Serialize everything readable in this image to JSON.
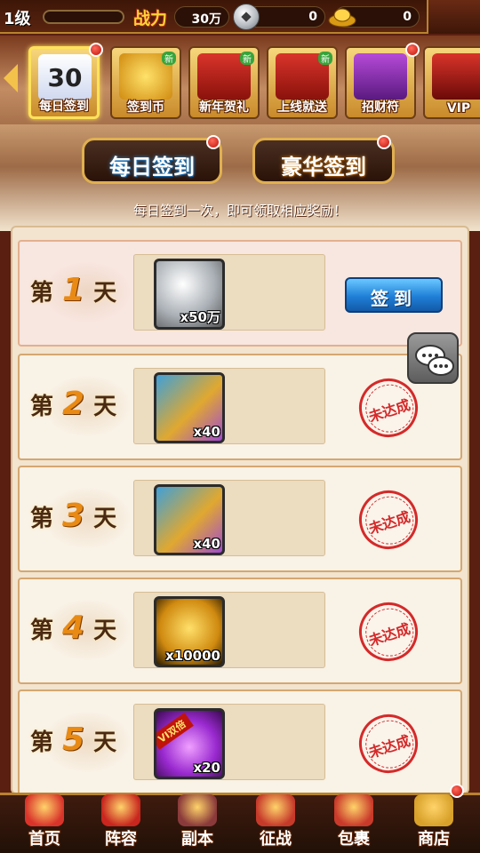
{
  "status": {
    "level": "1级",
    "power_label": "战力",
    "power_value": "30万",
    "coin_value": "0",
    "gold_value": "0"
  },
  "events": [
    {
      "label": "每日签到",
      "icon": "calendar-icon",
      "art_text": "30",
      "active": true,
      "dot": true,
      "new": false
    },
    {
      "label": "签到币",
      "icon": "coin-scroll-icon",
      "art_text": "",
      "active": false,
      "dot": false,
      "new": true
    },
    {
      "label": "新年贺礼",
      "icon": "gift-icon",
      "art_text": "",
      "active": false,
      "dot": false,
      "new": true
    },
    {
      "label": "上线就送",
      "icon": "gift-icon",
      "art_text": "",
      "active": false,
      "dot": false,
      "new": true
    },
    {
      "label": "招财符",
      "icon": "talisman-icon",
      "art_text": "",
      "active": false,
      "dot": true,
      "new": false
    },
    {
      "label": "VIP",
      "icon": "vip-icon",
      "art_text": "",
      "active": false,
      "dot": false,
      "new": false
    }
  ],
  "new_tag": "新",
  "tabs": {
    "daily": "每日签到",
    "luxury": "豪华签到"
  },
  "hint": "每日签到一次，即可领取相应奖励！",
  "day_prefix": "第",
  "day_suffix": "天",
  "days": [
    {
      "num": "1",
      "reward": "silver-coin-icon",
      "qty": "x50万",
      "status": "button",
      "button_label": "签到"
    },
    {
      "num": "2",
      "reward": "treasure-chest-icon",
      "qty": "x40",
      "status": "stamp",
      "stamp_label": "未达成"
    },
    {
      "num": "3",
      "reward": "treasure-chest-icon",
      "qty": "x40",
      "status": "stamp",
      "stamp_label": "未达成"
    },
    {
      "num": "4",
      "reward": "gold-ingot-icon",
      "qty": "x10000",
      "status": "stamp",
      "stamp_label": "未达成"
    },
    {
      "num": "5",
      "reward": "double-exp-gem-icon",
      "qty": "x20",
      "status": "stamp",
      "stamp_label": "未达成",
      "badge": "VI双倍"
    }
  ],
  "nav": [
    {
      "label": "首页",
      "icon": "palace-icon"
    },
    {
      "label": "阵容",
      "icon": "flag-icon"
    },
    {
      "label": "副本",
      "icon": "sword-icon"
    },
    {
      "label": "征战",
      "icon": "target-icon"
    },
    {
      "label": "包裹",
      "icon": "bag-icon"
    },
    {
      "label": "商店",
      "icon": "coins-icon"
    }
  ],
  "colors": {
    "accent_gold": "#ffd23a",
    "button_blue": "#1f7fd6",
    "stamp_red": "#d42a2a"
  }
}
